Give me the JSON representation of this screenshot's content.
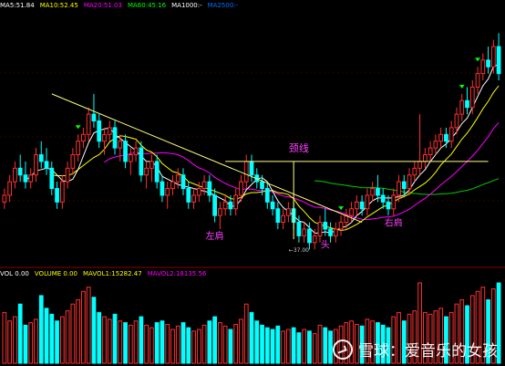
{
  "header": {
    "ma_labels": [
      {
        "text": "MA5:51.84",
        "color": "#ffffff"
      },
      {
        "text": "MA10:52.45",
        "color": "#ffff00"
      },
      {
        "text": "MA20:51.03",
        "color": "#ff00ff"
      },
      {
        "text": "MA60:45.16",
        "color": "#00ff00"
      },
      {
        "text": "MA1000:-",
        "color": "#ffffff"
      },
      {
        "text": "MA2500:-",
        "color": "#0070ff"
      }
    ]
  },
  "volume_header": {
    "labels": [
      {
        "text": "VOL 0.00",
        "color": "#ffffff"
      },
      {
        "text": "VOLUME 0.00",
        "color": "#ffff00"
      },
      {
        "text": "MAVOL1:15282.47",
        "color": "#ffff00"
      },
      {
        "text": "MAVOL2:18135.56",
        "color": "#ff00ff"
      }
    ]
  },
  "annotations": {
    "neckline": "颈线",
    "left_shoulder": "左肩",
    "head": "头",
    "right_shoulder": "右肩",
    "low_price": "←37.00"
  },
  "watermark": "雪球：爱音乐的女孩",
  "colors": {
    "up": "#ff3030",
    "down": "#00ffff",
    "ma5": "#ffffff",
    "ma10": "#ffff00",
    "ma20": "#ff00ff",
    "ma60": "#00cc00",
    "annotation": "#ff40ff",
    "trendline": "#ffff80"
  },
  "chart_data": {
    "type": "candlestick",
    "pattern": "inverse head and shoulders",
    "low_marker": 37.0,
    "ohlc": [
      [
        44,
        46,
        43,
        45
      ],
      [
        45,
        48,
        44,
        47
      ],
      [
        47,
        50,
        46,
        49
      ],
      [
        49,
        51,
        47,
        48
      ],
      [
        48,
        50,
        46,
        47
      ],
      [
        47,
        49,
        46,
        48
      ],
      [
        48,
        52,
        47,
        51
      ],
      [
        51,
        53,
        49,
        50
      ],
      [
        50,
        52,
        48,
        49
      ],
      [
        49,
        50,
        45,
        46
      ],
      [
        46,
        47,
        43,
        44
      ],
      [
        44,
        48,
        43,
        47
      ],
      [
        47,
        50,
        46,
        49
      ],
      [
        49,
        52,
        48,
        51
      ],
      [
        51,
        54,
        50,
        53
      ],
      [
        53,
        55,
        52,
        54
      ],
      [
        54,
        58,
        53,
        57
      ],
      [
        57,
        60,
        55,
        56
      ],
      [
        56,
        57,
        52,
        53
      ],
      [
        53,
        55,
        51,
        54
      ],
      [
        54,
        56,
        53,
        55
      ],
      [
        55,
        56,
        51,
        52
      ],
      [
        52,
        54,
        50,
        53
      ],
      [
        53,
        54,
        49,
        50
      ],
      [
        50,
        52,
        48,
        51
      ],
      [
        51,
        53,
        50,
        52
      ],
      [
        52,
        53,
        47,
        48
      ],
      [
        48,
        50,
        46,
        49
      ],
      [
        49,
        51,
        47,
        50
      ],
      [
        50,
        51,
        46,
        47
      ],
      [
        47,
        48,
        44,
        45
      ],
      [
        45,
        47,
        43,
        46
      ],
      [
        46,
        48,
        45,
        47
      ],
      [
        47,
        49,
        46,
        48
      ],
      [
        48,
        49,
        45,
        46
      ],
      [
        46,
        47,
        43,
        44
      ],
      [
        44,
        46,
        43,
        45
      ],
      [
        45,
        47,
        44,
        46
      ],
      [
        46,
        48,
        45,
        47
      ],
      [
        47,
        48,
        44,
        45
      ],
      [
        45,
        46,
        41,
        42
      ],
      [
        42,
        44,
        40,
        43
      ],
      [
        43,
        45,
        42,
        44
      ],
      [
        44,
        45,
        42,
        43
      ],
      [
        43,
        46,
        42,
        45
      ],
      [
        45,
        48,
        44,
        47
      ],
      [
        47,
        51,
        46,
        50
      ],
      [
        50,
        51,
        47,
        48
      ],
      [
        48,
        49,
        46,
        47
      ],
      [
        47,
        48,
        45,
        46
      ],
      [
        46,
        47,
        43,
        44
      ],
      [
        44,
        45,
        42,
        43
      ],
      [
        43,
        44,
        40,
        41
      ],
      [
        41,
        43,
        40,
        42
      ],
      [
        42,
        44,
        41,
        43
      ],
      [
        43,
        44,
        40,
        41
      ],
      [
        41,
        42,
        38,
        39
      ],
      [
        39,
        41,
        38,
        40
      ],
      [
        40,
        41,
        37,
        38
      ],
      [
        38,
        40,
        37,
        39
      ],
      [
        39,
        42,
        38,
        41
      ],
      [
        41,
        43,
        39,
        40
      ],
      [
        40,
        41,
        38,
        39
      ],
      [
        39,
        41,
        38,
        40
      ],
      [
        40,
        42,
        39,
        41
      ],
      [
        41,
        43,
        40,
        42
      ],
      [
        42,
        44,
        41,
        43
      ],
      [
        43,
        45,
        42,
        44
      ],
      [
        44,
        45,
        42,
        43
      ],
      [
        43,
        46,
        42,
        45
      ],
      [
        45,
        47,
        44,
        46
      ],
      [
        46,
        48,
        44,
        45
      ],
      [
        45,
        46,
        43,
        44
      ],
      [
        44,
        45,
        42,
        43
      ],
      [
        43,
        46,
        42,
        45
      ],
      [
        45,
        48,
        44,
        47
      ],
      [
        47,
        48,
        45,
        46
      ],
      [
        46,
        49,
        45,
        48
      ],
      [
        48,
        50,
        47,
        49
      ],
      [
        49,
        57,
        48,
        50
      ],
      [
        50,
        52,
        49,
        51
      ],
      [
        51,
        53,
        50,
        52
      ],
      [
        52,
        54,
        51,
        53
      ],
      [
        53,
        55,
        52,
        54
      ],
      [
        54,
        55,
        52,
        53
      ],
      [
        53,
        56,
        52,
        55
      ],
      [
        55,
        58,
        54,
        57
      ],
      [
        57,
        60,
        56,
        59
      ],
      [
        59,
        61,
        57,
        58
      ],
      [
        58,
        62,
        57,
        61
      ],
      [
        61,
        64,
        60,
        63
      ],
      [
        63,
        66,
        62,
        65
      ],
      [
        65,
        67,
        63,
        64
      ],
      [
        64,
        68,
        63,
        67
      ],
      [
        67,
        69,
        62,
        63
      ]
    ],
    "volume": [
      60,
      50,
      55,
      70,
      45,
      48,
      52,
      80,
      65,
      58,
      50,
      55,
      62,
      70,
      75,
      85,
      90,
      78,
      60,
      55,
      52,
      58,
      50,
      48,
      45,
      50,
      55,
      45,
      42,
      48,
      50,
      46,
      40,
      44,
      48,
      42,
      38,
      40,
      45,
      50,
      55,
      48,
      44,
      40,
      46,
      52,
      70,
      60,
      50,
      45,
      42,
      40,
      44,
      38,
      40,
      42,
      36,
      40,
      38,
      35,
      45,
      42,
      38,
      40,
      44,
      48,
      50,
      46,
      44,
      52,
      50,
      48,
      45,
      42,
      55,
      60,
      50,
      58,
      62,
      95,
      60,
      58,
      62,
      65,
      55,
      60,
      70,
      75,
      68,
      80,
      85,
      90,
      75,
      88,
      95
    ],
    "ylim": [
      35,
      72
    ]
  }
}
